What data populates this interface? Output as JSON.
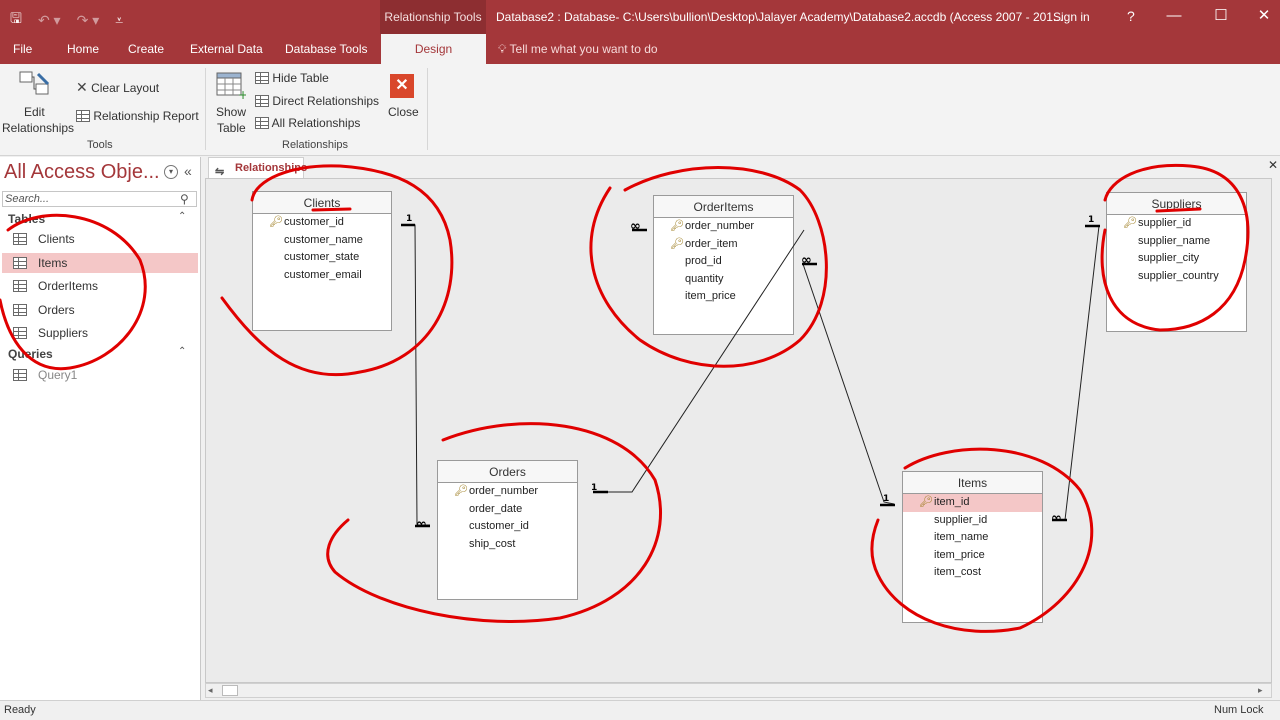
{
  "titlebar": {
    "context_group": "Relationship Tools",
    "document_title": "Database2 : Database- C:\\Users\\bullion\\Desktop\\Jalayer Academy\\Database2.accdb (Access 2007 - 201...",
    "sign_in": "Sign in",
    "help": "?",
    "minimize": "—",
    "restore": "☐",
    "close": "✕"
  },
  "tabs": {
    "file": "File",
    "home": "Home",
    "create": "Create",
    "external_data": "External Data",
    "database_tools": "Database Tools",
    "design": "Design",
    "tell_me": "Tell me what you want to do"
  },
  "ribbon": {
    "edit_relationships_1": "Edit",
    "edit_relationships_2": "Relationships",
    "clear_layout": "Clear Layout",
    "relationship_report": "Relationship Report",
    "tools_group": "Tools",
    "show_table_1": "Show",
    "show_table_2": "Table",
    "hide_table": "Hide Table",
    "direct_relationships": "Direct Relationships",
    "all_relationships": "All Relationships",
    "close": "Close",
    "relationships_group": "Relationships"
  },
  "nav": {
    "title": "All Access Obje...",
    "search_placeholder": "Search...",
    "tables_group": "Tables",
    "tables": [
      "Clients",
      "Items",
      "OrderItems",
      "Orders",
      "Suppliers"
    ],
    "queries_group": "Queries",
    "queries": [
      "Query1"
    ]
  },
  "document": {
    "tab": "Relationships"
  },
  "tables": {
    "clients": {
      "name": "Clients",
      "fields": [
        "customer_id",
        "customer_name",
        "customer_state",
        "customer_email"
      ]
    },
    "orderitems": {
      "name": "OrderItems",
      "fields": [
        "order_number",
        "order_item",
        "prod_id",
        "quantity",
        "item_price"
      ]
    },
    "suppliers": {
      "name": "Suppliers",
      "fields": [
        "supplier_id",
        "supplier_name",
        "supplier_city",
        "supplier_country"
      ]
    },
    "orders": {
      "name": "Orders",
      "fields": [
        "order_number",
        "order_date",
        "customer_id",
        "ship_cost"
      ]
    },
    "items": {
      "name": "Items",
      "fields": [
        "item_id",
        "supplier_id",
        "item_name",
        "item_price",
        "item_cost"
      ]
    }
  },
  "cardinality": {
    "one": "1",
    "many": "∞"
  },
  "status": {
    "left": "Ready",
    "right": "Num Lock"
  },
  "colors": {
    "accent": "#a4373a",
    "annotation": "#e00000",
    "selection": "#f4c7c7"
  },
  "icons": [
    "save-icon",
    "undo-icon",
    "redo-icon",
    "key-icon",
    "table-icon",
    "close-x-icon",
    "search-icon",
    "lightbulb-icon"
  ]
}
